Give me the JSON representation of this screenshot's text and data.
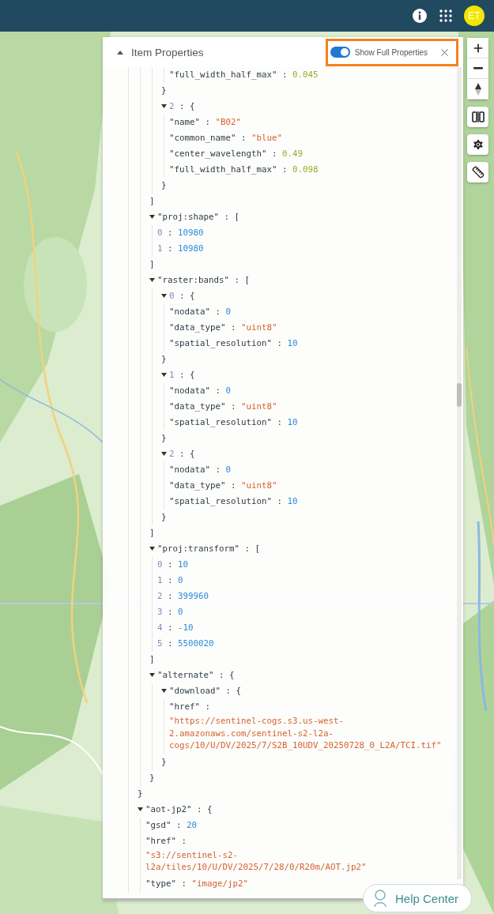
{
  "topbar": {
    "avatar": "ET"
  },
  "panel": {
    "title": "Item Properties",
    "expanded": true,
    "highlighted": true,
    "toggle": {
      "label": "Show Full Properties",
      "on": true
    },
    "separator": " : ",
    "tree": [
      {
        "children": [
          {
            "children": [
              {
                "children": [
                  {
                    "children": [
                      {
                        "key": "\"full_width_half_max\"",
                        "value": "0.045",
                        "kind": "float"
                      }
                    ],
                    "close": "}"
                  },
                  {
                    "index": "2",
                    "open": "{",
                    "expanded": true,
                    "children": [
                      {
                        "key": "\"name\"",
                        "value": "\"B02\"",
                        "kind": "string"
                      },
                      {
                        "key": "\"common_name\"",
                        "value": "\"blue\"",
                        "kind": "string"
                      },
                      {
                        "key": "\"center_wavelength\"",
                        "value": "0.49",
                        "kind": "float"
                      },
                      {
                        "key": "\"full_width_half_max\"",
                        "value": "0.098",
                        "kind": "float"
                      }
                    ],
                    "close": "}"
                  }
                ],
                "close": "]"
              },
              {
                "key": "\"proj:shape\"",
                "open": "[",
                "expanded": true,
                "children": [
                  {
                    "index": "0",
                    "value": "10980",
                    "kind": "number"
                  },
                  {
                    "index": "1",
                    "value": "10980",
                    "kind": "number"
                  }
                ],
                "close": "]"
              },
              {
                "key": "\"raster:bands\"",
                "open": "[",
                "expanded": true,
                "children": [
                  {
                    "index": "0",
                    "open": "{",
                    "expanded": true,
                    "children": [
                      {
                        "key": "\"nodata\"",
                        "value": "0",
                        "kind": "number"
                      },
                      {
                        "key": "\"data_type\"",
                        "value": "\"uint8\"",
                        "kind": "string"
                      },
                      {
                        "key": "\"spatial_resolution\"",
                        "value": "10",
                        "kind": "number"
                      }
                    ],
                    "close": "}"
                  },
                  {
                    "index": "1",
                    "open": "{",
                    "expanded": true,
                    "children": [
                      {
                        "key": "\"nodata\"",
                        "value": "0",
                        "kind": "number"
                      },
                      {
                        "key": "\"data_type\"",
                        "value": "\"uint8\"",
                        "kind": "string"
                      },
                      {
                        "key": "\"spatial_resolution\"",
                        "value": "10",
                        "kind": "number"
                      }
                    ],
                    "close": "}"
                  },
                  {
                    "index": "2",
                    "open": "{",
                    "expanded": true,
                    "children": [
                      {
                        "key": "\"nodata\"",
                        "value": "0",
                        "kind": "number"
                      },
                      {
                        "key": "\"data_type\"",
                        "value": "\"uint8\"",
                        "kind": "string"
                      },
                      {
                        "key": "\"spatial_resolution\"",
                        "value": "10",
                        "kind": "number"
                      }
                    ],
                    "close": "}"
                  }
                ],
                "close": "]"
              },
              {
                "key": "\"proj:transform\"",
                "open": "[",
                "expanded": true,
                "children": [
                  {
                    "index": "0",
                    "value": "10",
                    "kind": "number"
                  },
                  {
                    "index": "1",
                    "value": "0",
                    "kind": "number"
                  },
                  {
                    "index": "2",
                    "value": "399960",
                    "kind": "number"
                  },
                  {
                    "index": "3",
                    "value": "0",
                    "kind": "number"
                  },
                  {
                    "index": "4",
                    "value": "-10",
                    "kind": "number"
                  },
                  {
                    "index": "5",
                    "value": "5500020",
                    "kind": "number"
                  }
                ],
                "close": "]"
              },
              {
                "key": "\"alternate\"",
                "open": "{",
                "expanded": true,
                "children": [
                  {
                    "key": "\"download\"",
                    "open": "{",
                    "expanded": true,
                    "children": [
                      {
                        "key": "\"href\"",
                        "value": [
                          "\"https://sentinel-cogs.s3.us-west-",
                          "2.amazonaws.com/sentinel-s2-l2a-",
                          "cogs/10/U/DV/2025/7/S2B_10UDV_20250728_0_L2A/TCI.tif\""
                        ],
                        "kind": "string"
                      }
                    ],
                    "close": "}"
                  }
                ],
                "close": "}"
              }
            ],
            "close": "}"
          },
          {
            "key": "\"aot-jp2\"",
            "open": "{",
            "expanded": true,
            "children": [
              {
                "key": "\"gsd\"",
                "value": "20",
                "kind": "number"
              },
              {
                "key": "\"href\"",
                "value": [
                  "\"s3://sentinel-s2-",
                  "l2a/tiles/10/U/DV/2025/7/28/0/R20m/AOT.jp2\""
                ],
                "kind": "string"
              },
              {
                "key": "\"type\"",
                "value": "\"image/jp2\"",
                "kind": "string"
              }
            ]
          }
        ]
      }
    ]
  },
  "help": {
    "label": "Help Center"
  }
}
